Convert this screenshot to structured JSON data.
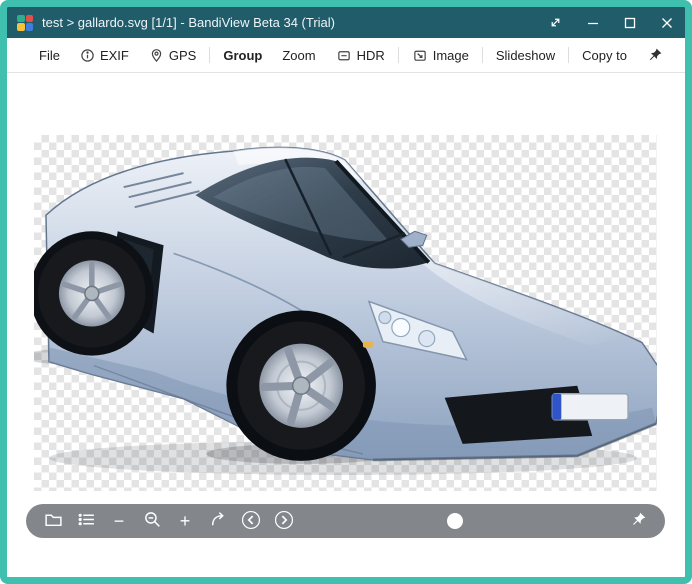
{
  "window": {
    "title": "test > gallardo.svg [1/1] - BandiView Beta 34 (Trial)"
  },
  "toolbar": {
    "items": [
      {
        "label": "File"
      },
      {
        "label": "EXIF",
        "icon": "info-icon"
      },
      {
        "label": "GPS",
        "icon": "gps-pin-icon"
      },
      {
        "label": "Group"
      },
      {
        "label": "Zoom"
      },
      {
        "label": "HDR",
        "icon": "hdr-box-icon"
      },
      {
        "label": "Image",
        "icon": "image-icon"
      },
      {
        "label": "Slideshow"
      },
      {
        "label": "Copy to"
      }
    ],
    "pin": "pin-icon"
  },
  "bottom_toolbar": {
    "buttons": [
      "folder-icon",
      "list-icon",
      "minus-icon",
      "magnifier-minus-icon",
      "plus-icon",
      "rotate-icon",
      "chevron-left-icon",
      "chevron-right-icon",
      "pin-icon"
    ],
    "zoom_out_glyph": "−",
    "zoom_in_glyph": "+",
    "slider_position_pct": 48
  },
  "icons": {
    "titlebar": [
      "fullscreen-icon",
      "minimize-icon",
      "maximize-icon",
      "close-icon"
    ],
    "app_logo": "bandiview-logo"
  },
  "colors": {
    "window_border": "#3fc0ae",
    "titlebar_bg": "#215c6b",
    "bottom_toolbar_bg": "#767a80",
    "car_body": "#b9c7db",
    "checker_gray": "#e4e4e4"
  }
}
